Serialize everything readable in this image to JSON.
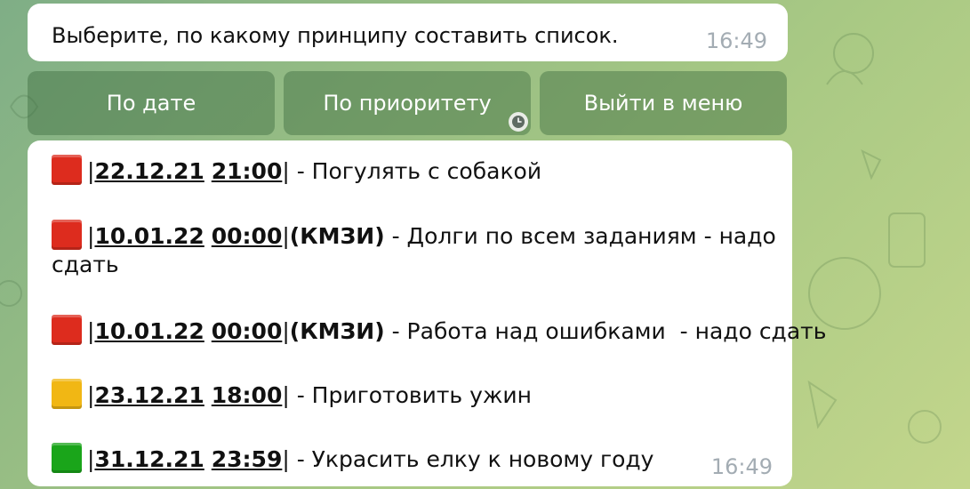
{
  "prompt_message": {
    "text": "Выберите, по какому принципу составить список.",
    "time": "16:49"
  },
  "keyboard": {
    "by_date": "По дате",
    "by_priority": "По приоритету",
    "exit_menu": "Выйти в меню"
  },
  "task_list": {
    "time": "16:49",
    "tasks": [
      {
        "priority_color": "red",
        "date": "22.12.21",
        "clock": "21:00",
        "tag": "",
        "text": "- Погулять с собакой"
      },
      {
        "priority_color": "red",
        "date": "10.01.22",
        "clock": "00:00",
        "tag": "(КМЗИ)",
        "text": "- Долги по всем заданиям - надо",
        "text_cont": "сдать"
      },
      {
        "priority_color": "red",
        "date": "10.01.22",
        "clock": "00:00",
        "tag": "(КМЗИ)",
        "text": "- Работа над ошибками  - надо сдать"
      },
      {
        "priority_color": "yellow",
        "date": "23.12.21",
        "clock": "18:00",
        "tag": "",
        "text": "- Приготовить ужин"
      },
      {
        "priority_color": "green",
        "date": "31.12.21",
        "clock": "23:59",
        "tag": "",
        "text": "- Украсить елку к новому году"
      }
    ]
  },
  "colors": {
    "red": "#dd2c1e",
    "yellow": "#f1b714",
    "green": "#1aa51a"
  }
}
